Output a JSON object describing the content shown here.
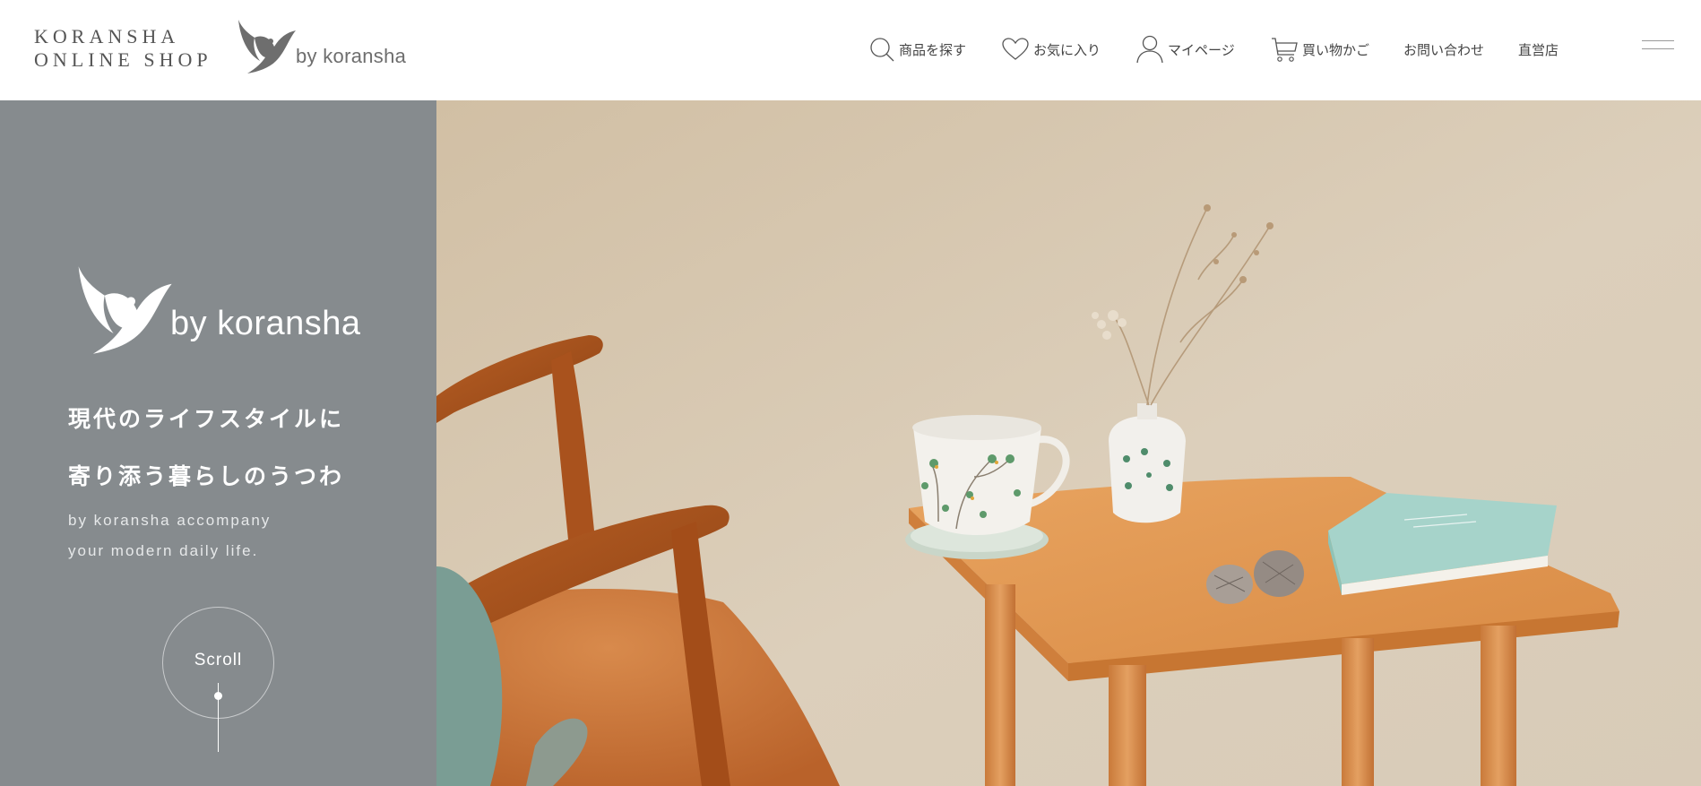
{
  "header": {
    "shop_logo_line1": "KORANSHA",
    "shop_logo_line2": "ONLINE SHOP",
    "brand_logo_text": "by koransha"
  },
  "nav": {
    "items": [
      {
        "label": "商品を探す",
        "icon": "search-icon"
      },
      {
        "label": "お気に入り",
        "icon": "heart-icon"
      },
      {
        "label": "マイページ",
        "icon": "user-icon"
      },
      {
        "label": "買い物かご",
        "icon": "cart-icon"
      },
      {
        "label": "お問い合わせ",
        "icon": ""
      },
      {
        "label": "直営店",
        "icon": ""
      }
    ],
    "menu_icon": "hamburger-icon"
  },
  "hero": {
    "brand_logo_text": "by koransha",
    "tagline_jp_line1": "現代のライフスタイルに",
    "tagline_jp_line2": "寄り添う暮らしのうつわ",
    "tagline_en_line1": "by koransha accompany",
    "tagline_en_line2": "your modern daily life.",
    "scroll_label": "Scroll"
  },
  "colors": {
    "panel_bg": "#868b8e",
    "text_dark": "#444444",
    "photo_wall": "#d6c8b1",
    "wood": "#d98b45",
    "chair_leather": "#c86a2b",
    "book": "#9ed0c8"
  }
}
